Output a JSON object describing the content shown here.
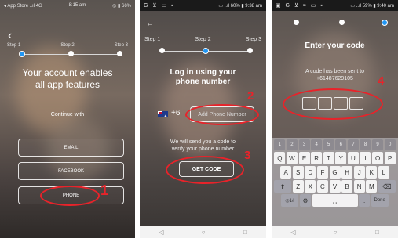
{
  "screen1": {
    "status_left": "◂ App Store ..ıl 4G",
    "status_time": "8:15 am",
    "status_right": "◎ ▮ 66%",
    "steps": [
      "Step 1",
      "Step 2",
      "Step 3"
    ],
    "headline": "Your account enables all app features",
    "continue_label": "Continue with",
    "buttons": {
      "email": "EMAIL",
      "facebook": "FACEBOOK",
      "phone": "PHONE"
    },
    "annotation": "1"
  },
  "screen2": {
    "status_left": "G ⊻ ▭ ▪",
    "status_right": "▭ ..ıl 60% ▮ 9:38 am",
    "steps": [
      "Step 1",
      "Step 2",
      "Step 3"
    ],
    "title": "Log in using your phone number",
    "country_code": "+6",
    "phone_placeholder": "Add Phone Number",
    "info": "We will send you a code to verify your phone number",
    "get_code": "GET CODE",
    "annotation_input": "2",
    "annotation_button": "3"
  },
  "screen3": {
    "status_left": "▣ G ⊻ ≈ ▭ ▪",
    "status_right": "▭ ..ıl 59% ▮ 9:40 am",
    "title": "Enter your code",
    "sent_label": "A code has been sent to",
    "sent_number": "+61487629105",
    "annotation": "4",
    "keyboard": {
      "numbers": [
        "1",
        "2",
        "3",
        "4",
        "5",
        "6",
        "7",
        "8",
        "9",
        "0"
      ],
      "row1": [
        "Q",
        "W",
        "E",
        "R",
        "T",
        "Y",
        "U",
        "I",
        "O",
        "P"
      ],
      "row2": [
        "A",
        "S",
        "D",
        "F",
        "G",
        "H",
        "J",
        "K",
        "L"
      ],
      "row3": [
        "Z",
        "X",
        "C",
        "V",
        "B",
        "N",
        "M"
      ],
      "shift": "⬆",
      "backspace": "⌫",
      "sym": "◎1#",
      "done": "Done"
    }
  },
  "navbar": {
    "back": "◁",
    "home": "○",
    "recent": "□"
  }
}
